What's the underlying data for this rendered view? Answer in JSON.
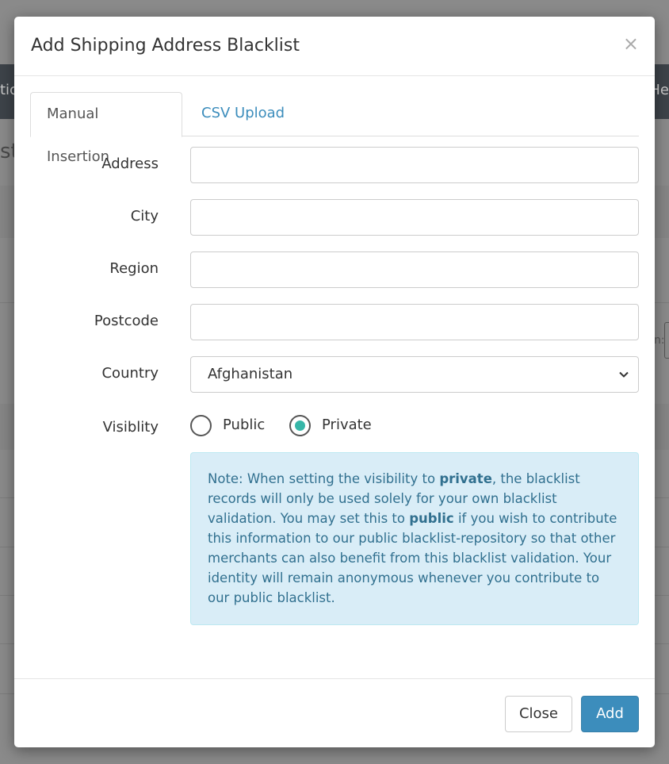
{
  "background": {
    "nav_left_text": "tic",
    "nav_right_text": "He",
    "heading_fragment": "st",
    "colon_fragment": "n:"
  },
  "modal": {
    "title": "Add Shipping Address Blacklist",
    "close_symbol": "×",
    "tabs": [
      {
        "label": "Manual Insertion",
        "active": true
      },
      {
        "label": "CSV Upload",
        "active": false
      }
    ],
    "fields": {
      "address": {
        "label": "Address",
        "value": ""
      },
      "city": {
        "label": "City",
        "value": ""
      },
      "region": {
        "label": "Region",
        "value": ""
      },
      "postcode": {
        "label": "Postcode",
        "value": ""
      },
      "country": {
        "label": "Country",
        "selected": "Afghanistan"
      },
      "visibility": {
        "label": "Visiblity",
        "options": [
          {
            "label": "Public",
            "checked": false
          },
          {
            "label": "Private",
            "checked": true
          }
        ]
      }
    },
    "note": {
      "prefix": "Note: When setting the visibility to ",
      "bold1": "private",
      "middle": ", the blacklist records will only be used solely for your own blacklist validation. You may set this to ",
      "bold2": "public",
      "suffix": " if you wish to contribute this information to our public blacklist-repository so that other merchants can also benefit from this blacklist validation. Your identity will remain anonymous whenever you contribute to our public blacklist."
    },
    "footer": {
      "close_label": "Close",
      "add_label": "Add"
    }
  },
  "colors": {
    "primary": "#3c8dbc",
    "radio_checked": "#36b6a8",
    "note_bg": "#d9edf7",
    "note_text": "#31708f"
  }
}
